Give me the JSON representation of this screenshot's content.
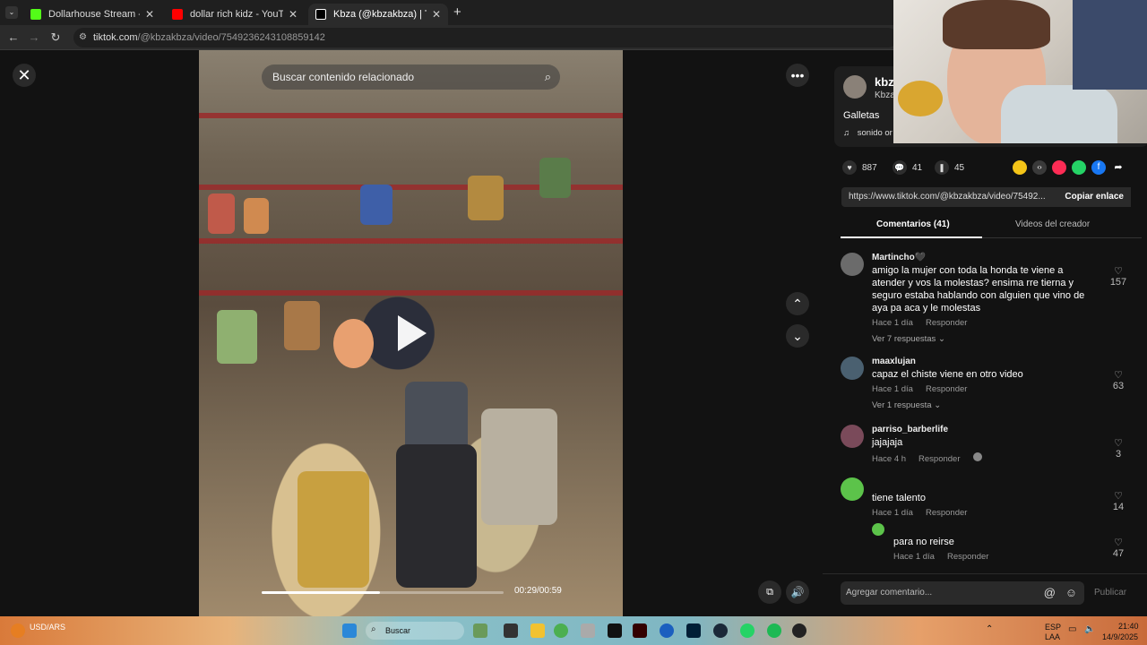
{
  "browser": {
    "tabs": [
      {
        "title": "Dollarhouse Stream - Watch Li",
        "favicon_color": "#53fc18",
        "icon": "kick-icon"
      },
      {
        "title": "dollar rich kidz - YouTube",
        "favicon_color": "#ff0000",
        "icon": "youtube-icon"
      },
      {
        "title": "Kbza (@kbzakbza) | TikTok",
        "favicon_color": "#ffffff",
        "icon": "tiktok-icon"
      }
    ],
    "url_host": "tiktok.com",
    "url_path": "/@kbzakbza/video/7549236243108859142"
  },
  "video": {
    "search_placeholder": "Buscar contenido relacionado",
    "time": "00:29/00:59",
    "progress_fraction": 0.49
  },
  "author": {
    "name_short": "kbz",
    "display_short": "Kbza",
    "caption": "Galletas",
    "sound": "sonido or"
  },
  "stats": {
    "likes": "887",
    "comments": "41",
    "saves": "45"
  },
  "share": {
    "link": "https://www.tiktok.com/@kbzakbza/video/75492...",
    "copy_label": "Copiar enlace"
  },
  "panel_tabs": {
    "comments": "Comentarios (41)",
    "creator_videos": "Videos del creador"
  },
  "comments": [
    {
      "user": "Martincho🖤",
      "text": "amigo la mujer con toda la honda te viene a atender y vos la molestas? ensima rre tierna y seguro estaba hablando con alguien que vino de aya pa aca y le molestas",
      "time": "Hace 1 día",
      "reply": "Responder",
      "more": "Ver 7 respuestas",
      "likes": "157"
    },
    {
      "user": "maaxlujan",
      "text": "capaz el chiste viene en otro video",
      "time": "Hace 1 día",
      "reply": "Responder",
      "more": "Ver 1 respuesta",
      "likes": "63"
    },
    {
      "user": "parriso_barberlife",
      "text": "jajajaja",
      "time": "Hace 4 h",
      "reply": "Responder",
      "likes": "3"
    },
    {
      "user": "",
      "text": "tiene talento",
      "time": "Hace 1 día",
      "reply": "Responder",
      "likes": "14"
    },
    {
      "user": "",
      "text": "para no reirse",
      "time": "Hace 1 día",
      "reply": "Responder",
      "likes": "47"
    }
  ],
  "comment_bar": {
    "placeholder": "Agregar comentario...",
    "publish": "Publicar"
  },
  "taskbar": {
    "currency": "USD/ARS",
    "search": "Buscar",
    "lang": "ESP",
    "lang2": "LAA",
    "time": "21:40",
    "date": "14/9/2025"
  }
}
